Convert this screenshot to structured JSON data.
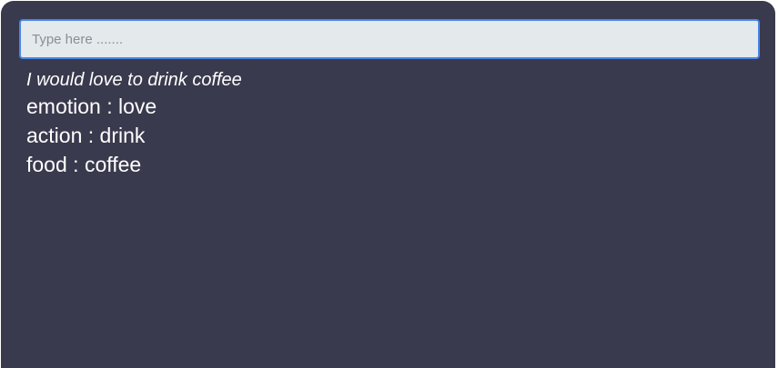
{
  "search": {
    "placeholder": "Type here .......",
    "value": ""
  },
  "result": {
    "sentence": "I would love to drink coffee",
    "tags": [
      {
        "label": "emotion",
        "separator": " : ",
        "value": "love"
      },
      {
        "label": "action",
        "separator": " : ",
        "value": "drink"
      },
      {
        "label": "food",
        "separator": " : ",
        "value": "coffee"
      }
    ]
  },
  "colors": {
    "panel_background": "#3a3a4e",
    "input_background": "#e4e9ec",
    "input_border": "#4a86e8",
    "text": "#ffffff"
  }
}
